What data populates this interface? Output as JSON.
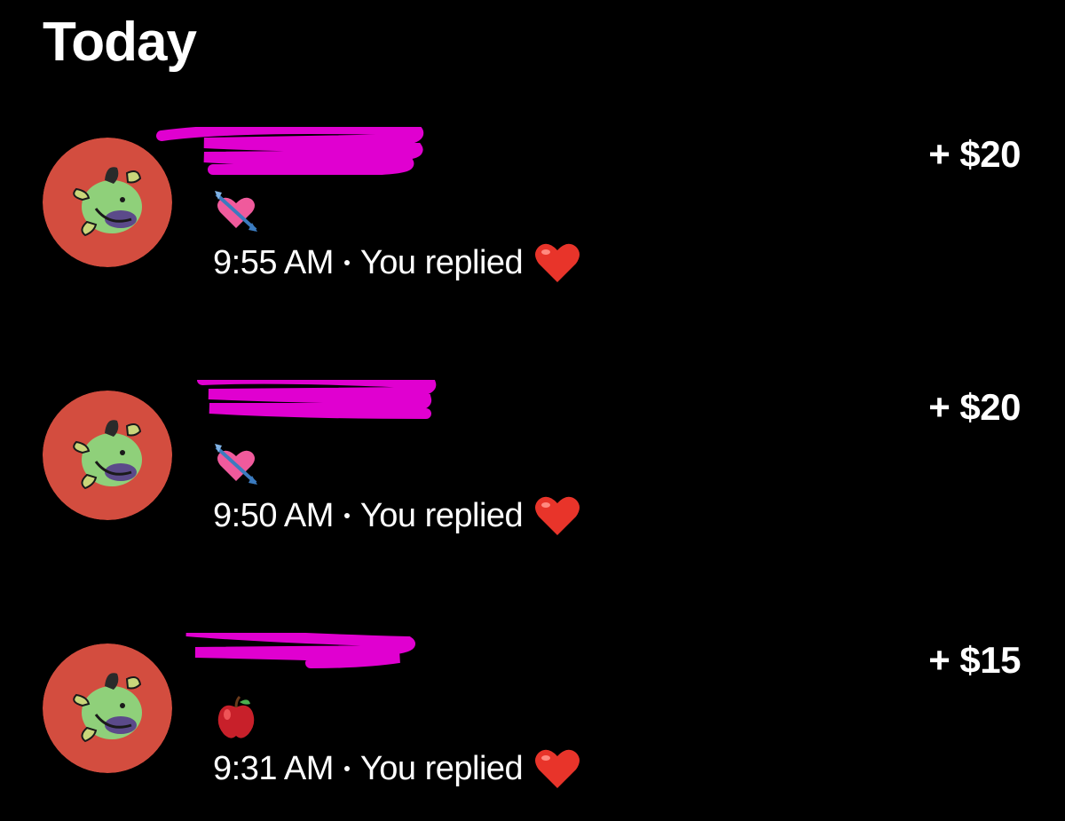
{
  "header": {
    "title": "Today"
  },
  "colors": {
    "background": "#000000",
    "text": "#ffffff",
    "avatar_bg": "#d34d3f",
    "redaction": "#e000d0",
    "heart": "#e8342a"
  },
  "notifications": [
    {
      "message_emoji": "heart-with-arrow",
      "time": "9:55 AM",
      "status": "You replied",
      "reaction_emoji": "red-heart",
      "amount": "+ $20"
    },
    {
      "message_emoji": "heart-with-arrow",
      "time": "9:50 AM",
      "status": "You replied",
      "reaction_emoji": "red-heart",
      "amount": "+ $20"
    },
    {
      "message_emoji": "red-apple",
      "time": "9:31 AM",
      "status": "You replied",
      "reaction_emoji": "red-heart",
      "amount": "+ $15"
    }
  ]
}
